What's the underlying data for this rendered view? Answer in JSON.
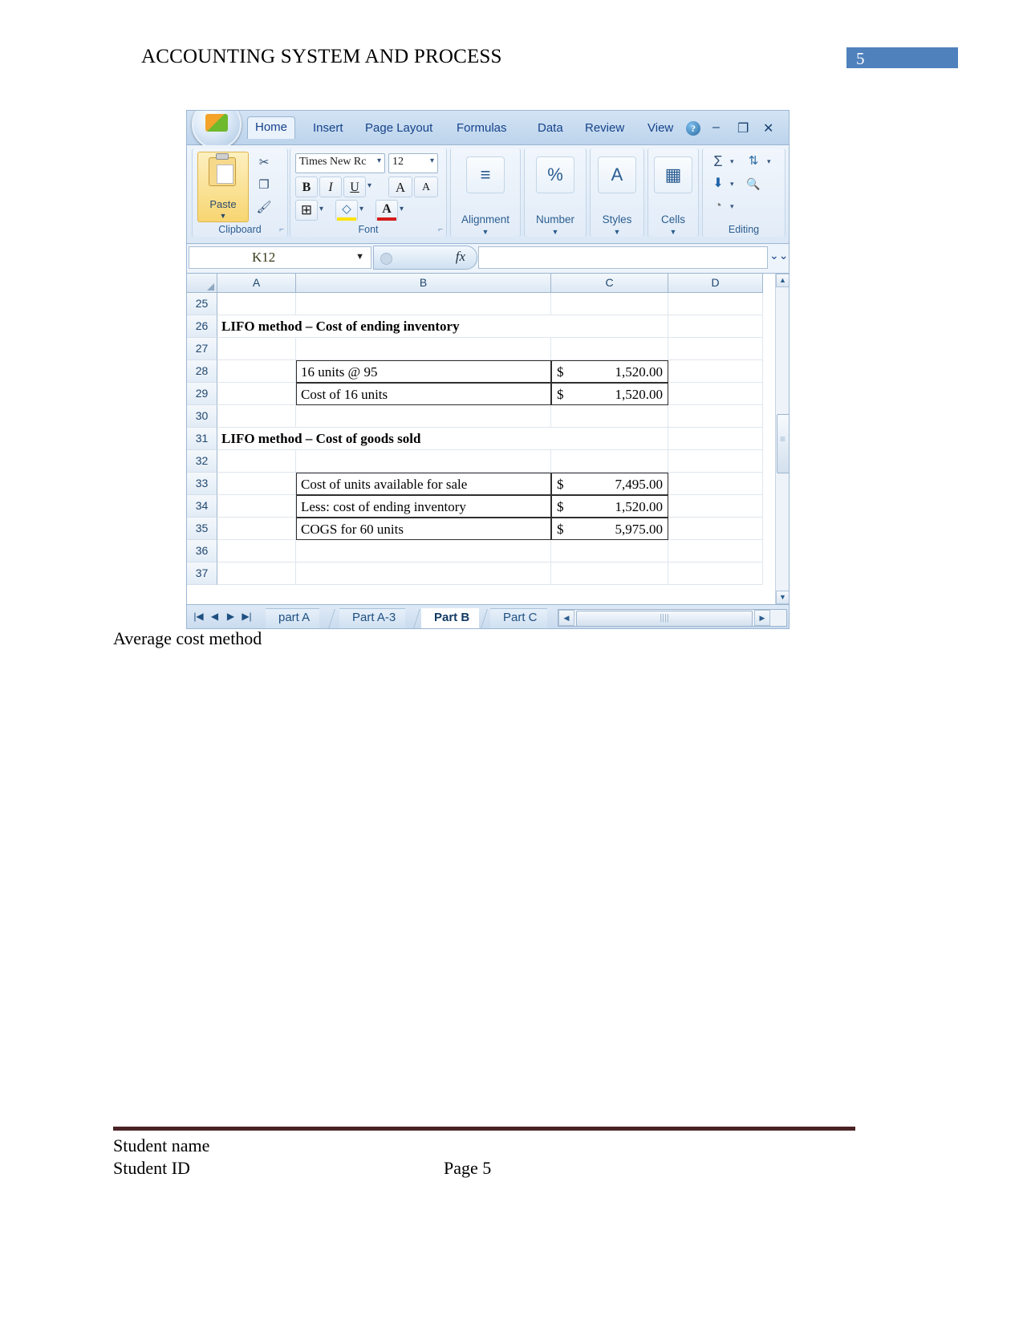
{
  "page": {
    "header_title": "ACCOUNTING SYSTEM AND PROCESS",
    "page_badge_number": "5",
    "badge_color": "#4f81bd",
    "caption": "Average cost method",
    "footer": {
      "student_name": "Student name",
      "student_id": "Student ID",
      "page_label": "Page 5",
      "rule_color": "#4b2326"
    }
  },
  "excel": {
    "ribbon_tabs": [
      {
        "label": "Home",
        "active": true
      },
      {
        "label": "Insert",
        "active": false
      },
      {
        "label": "Page Layout",
        "active": false
      },
      {
        "label": "Formulas",
        "active": false
      },
      {
        "label": "Data",
        "active": false
      },
      {
        "label": "Review",
        "active": false
      },
      {
        "label": "View",
        "active": false
      }
    ],
    "window_controls": {
      "help": "?",
      "minimize": "–",
      "restore": "❐",
      "close": "✕"
    },
    "clipboard_group": {
      "label": "Clipboard",
      "paste_label": "Paste",
      "paste_caret": "▼",
      "cut_icon": "✂",
      "copy_icon": "❐",
      "format_painter_icon": "🖌",
      "launcher": "⌐"
    },
    "font_group": {
      "label": "Font",
      "font_name": "Times New Rc",
      "font_size": "12",
      "bold": "B",
      "italic": "I",
      "underline": "U",
      "grow_font": "A",
      "shrink_font": "A",
      "borders_icon": "⊞",
      "fill_color_icon": "◇",
      "font_color_icon": "A",
      "launcher": "⌐"
    },
    "collapsed_groups": [
      {
        "label": "Alignment",
        "icon": "≡",
        "caret": "▼"
      },
      {
        "label": "Number",
        "icon": "%",
        "caret": "▼"
      },
      {
        "label": "Styles",
        "icon": "A",
        "caret": "▼"
      },
      {
        "label": "Cells",
        "icon": "▦",
        "caret": "▼"
      }
    ],
    "editing_group": {
      "label": "Editing",
      "autosum_icon": "Σ",
      "sort_filter_icon": "A\nZ",
      "fill_icon": "⬇",
      "find_select_icon": "🔍",
      "clear_icon": "◔",
      "caret": "▼"
    },
    "formula_bar": {
      "name_box_value": "K12",
      "name_box_caret": "▼",
      "fx_label": "fx",
      "formula_value": "",
      "expand_icon": "⌄⌄"
    },
    "grid": {
      "select_all_icon": "◢",
      "columns": [
        "A",
        "B",
        "C",
        "D"
      ],
      "rows": [
        {
          "num": "25",
          "b": "",
          "c_cur": "",
          "c_amt": "",
          "bold": false,
          "boxed": false,
          "a_span": ""
        },
        {
          "num": "26",
          "b": "",
          "c_cur": "",
          "c_amt": "",
          "bold": true,
          "boxed": false,
          "a_span": "LIFO method – Cost of ending inventory"
        },
        {
          "num": "27",
          "b": "",
          "c_cur": "",
          "c_amt": "",
          "bold": false,
          "boxed": false,
          "a_span": ""
        },
        {
          "num": "28",
          "b": "16 units @ 95",
          "c_cur": "$",
          "c_amt": "1,520.00",
          "bold": false,
          "boxed": true,
          "a_span": ""
        },
        {
          "num": "29",
          "b": "Cost of 16 units",
          "c_cur": "$",
          "c_amt": "1,520.00",
          "bold": false,
          "boxed": true,
          "a_span": ""
        },
        {
          "num": "30",
          "b": "",
          "c_cur": "",
          "c_amt": "",
          "bold": false,
          "boxed": false,
          "a_span": ""
        },
        {
          "num": "31",
          "b": "",
          "c_cur": "",
          "c_amt": "",
          "bold": true,
          "boxed": false,
          "a_span": "LIFO method – Cost of goods sold"
        },
        {
          "num": "32",
          "b": "",
          "c_cur": "",
          "c_amt": "",
          "bold": false,
          "boxed": false,
          "a_span": ""
        },
        {
          "num": "33",
          "b": "Cost of units available for sale",
          "c_cur": "$",
          "c_amt": "7,495.00",
          "bold": false,
          "boxed": true,
          "a_span": ""
        },
        {
          "num": "34",
          "b": "Less: cost of ending inventory",
          "c_cur": "$",
          "c_amt": "1,520.00",
          "bold": false,
          "boxed": true,
          "a_span": ""
        },
        {
          "num": "35",
          "b": "COGS for 60 units",
          "c_cur": "$",
          "c_amt": "5,975.00",
          "bold": false,
          "boxed": true,
          "a_span": ""
        },
        {
          "num": "36",
          "b": "",
          "c_cur": "",
          "c_amt": "",
          "bold": false,
          "boxed": false,
          "a_span": ""
        },
        {
          "num": "37",
          "b": "",
          "c_cur": "",
          "c_amt": "",
          "bold": false,
          "boxed": false,
          "a_span": ""
        }
      ]
    },
    "sheet_tabs": {
      "nav_first": "|◀",
      "nav_prev": "◀",
      "nav_next": "▶",
      "nav_last": "▶|",
      "tabs": [
        {
          "label": "part A",
          "active": false
        },
        {
          "label": "Part A-3",
          "active": false
        },
        {
          "label": "Part B",
          "active": true
        },
        {
          "label": "Part C",
          "active": false
        }
      ],
      "hscroll_left": "◀",
      "hscroll_right": "▶",
      "hscroll_grip": "||||"
    }
  }
}
